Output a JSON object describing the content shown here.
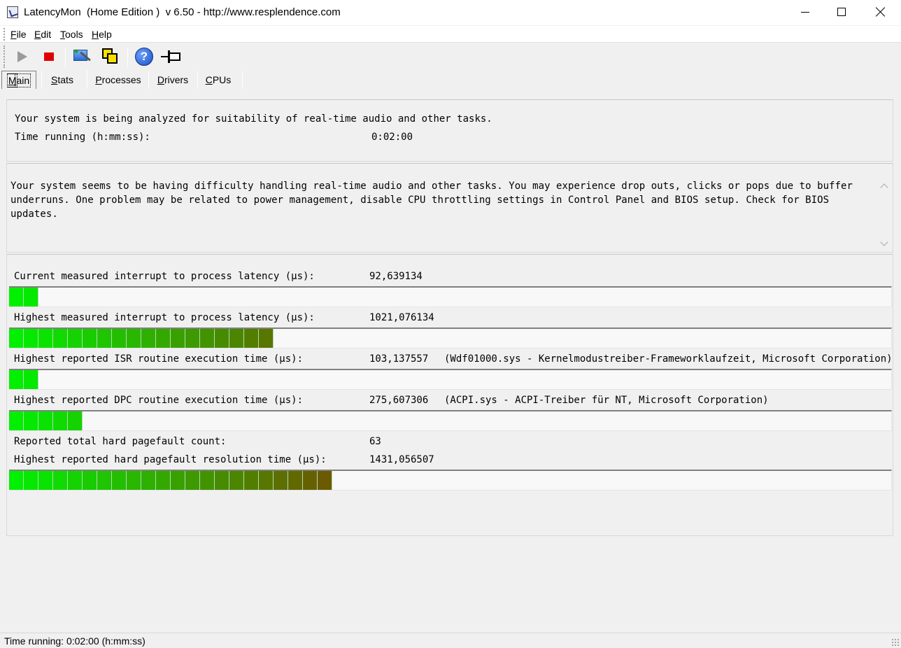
{
  "window": {
    "title": "LatencyMon  (Home Edition )  v 6.50 - http://www.resplendence.com",
    "app_icon": "latencymon-app-icon",
    "controls": [
      "minimize-icon",
      "maximize-icon",
      "close-icon"
    ]
  },
  "menu": {
    "items": [
      {
        "label": "File",
        "mnemonic": "F",
        "rest": "ile"
      },
      {
        "label": "Edit",
        "mnemonic": "E",
        "rest": "dit"
      },
      {
        "label": "Tools",
        "mnemonic": "T",
        "rest": "ools"
      },
      {
        "label": "Help",
        "mnemonic": "H",
        "rest": "elp"
      }
    ]
  },
  "toolbar": {
    "buttons": [
      "play-icon",
      "stop-icon",
      "wizard-icon",
      "windows-icon",
      "help-icon",
      "pin-icon"
    ],
    "colors": {
      "stop": "#e00000",
      "play_disabled": "#9a9a9a",
      "help": "#1a4fc0",
      "windows": "#f4e000"
    }
  },
  "tabs": [
    {
      "label": "Main",
      "mnemonic": "M",
      "rest": "ain",
      "active": true
    },
    {
      "label": "Stats",
      "mnemonic": "S",
      "rest": "tats",
      "active": false
    },
    {
      "label": "Processes",
      "mnemonic": "P",
      "rest": "rocesses",
      "active": false
    },
    {
      "label": "Drivers",
      "mnemonic": "D",
      "rest": "rivers",
      "active": false
    },
    {
      "label": "CPUs",
      "mnemonic": "C",
      "rest": "PUs",
      "active": false
    }
  ],
  "status_panel": {
    "line1": "Your system is being analyzed for suitability of real-time audio and other tasks.",
    "time_label": "Time running (h:mm:ss):",
    "time_value": "0:02:00"
  },
  "verdict": {
    "text": "Your system seems to be having difficulty handling real-time audio and other tasks. You may experience drop outs, clicks or pops due to buffer underruns. One problem may be related to power management, disable CPU throttling settings in Control Panel and BIOS setup. Check for BIOS updates."
  },
  "metrics": [
    {
      "label": "Current measured interrupt to process latency (µs):",
      "value": "92,639134",
      "note": "",
      "bar_segments": 2
    },
    {
      "label": "Highest measured interrupt to process latency (µs):",
      "value": "1021,076134",
      "note": "",
      "bar_segments": 18
    },
    {
      "label": "Highest reported ISR routine execution time (µs):",
      "value": "103,137557",
      "note": "(Wdf01000.sys - Kernelmodustreiber-Frameworklaufzeit, Microsoft Corporation)",
      "bar_segments": 2
    },
    {
      "label": "Highest reported DPC routine execution time (µs):",
      "value": "275,607306",
      "note": "(ACPI.sys - ACPI-Treiber für NT, Microsoft Corporation)",
      "bar_segments": 5
    },
    {
      "label": "Reported total hard pagefault count:",
      "value": "63",
      "note": ""
    },
    {
      "label": "Highest reported hard pagefault resolution time (µs):",
      "value": "1431,056507",
      "note": "",
      "bar_segments": 22
    }
  ],
  "bar_colors": {
    "start": "#00f000",
    "end": "#6b5a00"
  },
  "statusbar": {
    "text": "Time running: 0:02:00  (h:mm:ss)"
  }
}
